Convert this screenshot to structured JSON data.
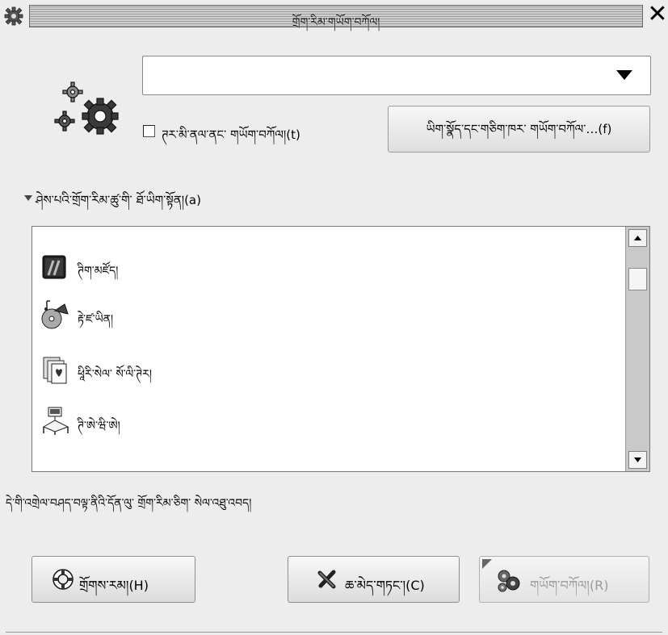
{
  "window": {
    "title": "གྲོག་རིམ་གཡོག་བཀོལ།",
    "close_glyph": "✕"
  },
  "combo": {
    "value": "",
    "arrow_icon": "triangle-down-icon"
  },
  "checkbox": {
    "label": "ཊར་མི་ནལ་ནང་ གཡོག་བཀོལ།(t)",
    "checked": false
  },
  "find_file_button": {
    "label": "ཡིག་སྣོད་དང་གཅིག་ཁར་ གཡོག་བཀོལ་…(f)"
  },
  "expander": {
    "label": "ཤེས་པའི་གྲོག་རིམ་ཚུ་གི་ ཐོ་ཡིག་སྟོན།(a)"
  },
  "list": {
    "items": [
      {
        "icon": "terminal-icon",
        "label": "ཊིག་མཛོད།"
      },
      {
        "icon": "media-player-icon",
        "label": "རྟེ་ཛ་ཡིན།"
      },
      {
        "icon": "solitaire-cards-icon",
        "label": "ཕཱིརི་སེལ་ སོ་ལི་ཊེར།"
      },
      {
        "icon": "network-icon",
        "label": "ཊི་ཨེ་ཝི་ཨེ།"
      }
    ]
  },
  "description": "དེ་གི་འགྲེལ་བཤད་བལྟ་ནིའི་དོན་ལུ་ གྲོག་རིམ་ཅིག་ སེལ་འཐུ་འབད།",
  "buttons": {
    "help": {
      "label": "གྲོགས་རམ།(H)",
      "icon": "lifebuoy-icon"
    },
    "cancel": {
      "label": "ཆ་མེད་གཏང་།(C)",
      "icon": "cross-icon"
    },
    "run": {
      "label": "གཡོག་བཀོལ།(R)",
      "icon": "run-gears-icon",
      "enabled": false
    }
  },
  "colors": {
    "background": "#ededed",
    "disabled_text": "#9a9a9a"
  }
}
